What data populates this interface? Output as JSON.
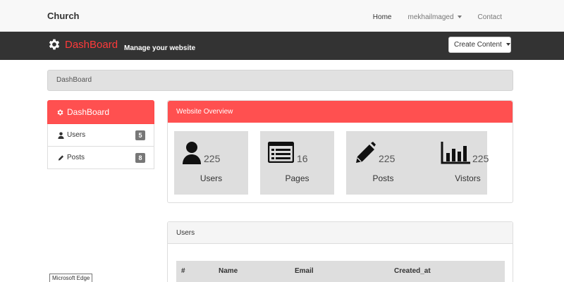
{
  "navbar": {
    "brand": "Church",
    "links": [
      {
        "label": "Home",
        "active": true
      },
      {
        "label": "mekhailmaged",
        "dropdown": true
      },
      {
        "label": "Contact"
      }
    ]
  },
  "header": {
    "title": "DashBoard",
    "subtitle": "Manage your website",
    "create_button": "Create Content",
    "accent_color": "#ff3a3a",
    "background_color": "#333333"
  },
  "breadcrumb": "DashBoard",
  "sidebar": {
    "heading": "DashBoard",
    "items": [
      {
        "label": "Users",
        "count": "5",
        "icon": "user-icon"
      },
      {
        "label": "Posts",
        "count": "8",
        "icon": "pencil-icon"
      }
    ]
  },
  "overview": {
    "heading": "Website Overview",
    "stats": [
      {
        "label": "Users",
        "value": "225",
        "icon": "user-icon"
      },
      {
        "label": "Pages",
        "value": "16",
        "icon": "list-icon"
      },
      {
        "label": "Posts",
        "value": "225",
        "icon": "pencil-icon"
      },
      {
        "label": "Vistors",
        "value": "225",
        "icon": "bar-chart-icon"
      }
    ]
  },
  "users_panel": {
    "heading": "Users",
    "columns": [
      "#",
      "Name",
      "Email",
      "Created_at"
    ]
  },
  "tooltip": "Microsoft Edge"
}
